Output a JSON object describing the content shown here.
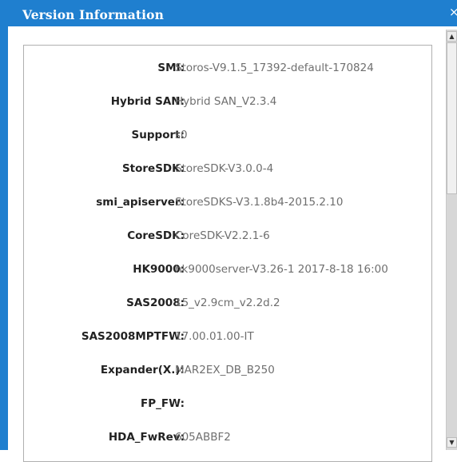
{
  "dialog": {
    "title": "Version Information",
    "close_glyph": "×"
  },
  "rows": [
    {
      "label": "SMI:",
      "value": "Storos-V9.1.5_17392-default-170824"
    },
    {
      "label": "Hybrid SAN:",
      "value": "Hybrid SAN_V2.3.4"
    },
    {
      "label": "Support:",
      "value": "s0"
    },
    {
      "label": "StoreSDK:",
      "value": "StoreSDK-V3.0.0-4"
    },
    {
      "label": "smi_apiserver:",
      "value": "StoreSDKS-V3.1.8b4-2015.2.10"
    },
    {
      "label": "CoreSDK:",
      "value": "CoreSDK-V2.2.1-6"
    },
    {
      "label": "HK9000:",
      "value": "hk9000server-V3.26-1 2017-8-18 16:00"
    },
    {
      "label": "SAS2008:",
      "value": "15_v2.9cm_v2.2d.2"
    },
    {
      "label": "SAS2008MPTFW:",
      "value": "17.00.01.00-IT"
    },
    {
      "label": "Expander(X.):",
      "value": "MAR2EX_DB_B250"
    },
    {
      "label": "FP_FW:",
      "value": "-"
    },
    {
      "label": "HDA_FwRev:",
      "value": "605ABBF2"
    }
  ],
  "scrollbar": {
    "up_icon": "up-arrow-icon",
    "down_icon": "down-arrow-icon"
  },
  "colors": {
    "titlebar": "#1f7fcf",
    "label_text": "#222222",
    "value_text": "#6f6f6f"
  }
}
